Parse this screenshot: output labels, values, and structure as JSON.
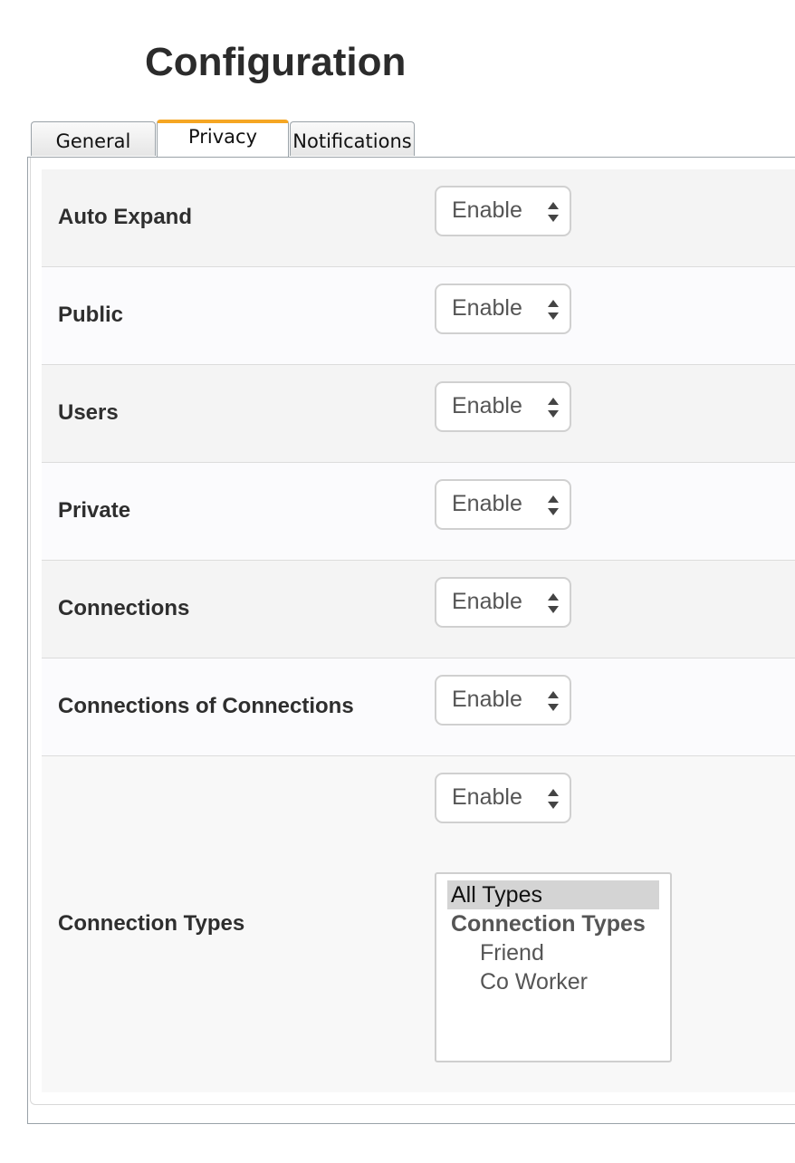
{
  "page": {
    "title": "Configuration"
  },
  "tabs": [
    {
      "label": "General",
      "active": false
    },
    {
      "label": "Privacy",
      "active": true
    },
    {
      "label": "Notifications",
      "active": false
    }
  ],
  "settings": [
    {
      "label": "Auto Expand",
      "value": "Enable"
    },
    {
      "label": "Public",
      "value": "Enable"
    },
    {
      "label": "Users",
      "value": "Enable"
    },
    {
      "label": "Private",
      "value": "Enable"
    },
    {
      "label": "Connections",
      "value": "Enable"
    },
    {
      "label": "Connections of Connections",
      "value": "Enable"
    },
    {
      "label": "Connection Types",
      "value": "Enable"
    }
  ],
  "connection_types_list": {
    "selected": "All Types",
    "group_label": "Connection Types",
    "options": [
      "Friend",
      "Co Worker"
    ]
  },
  "colors": {
    "active_tab_accent": "#f5a623",
    "selected_option_bg": "#d4d4d4"
  }
}
